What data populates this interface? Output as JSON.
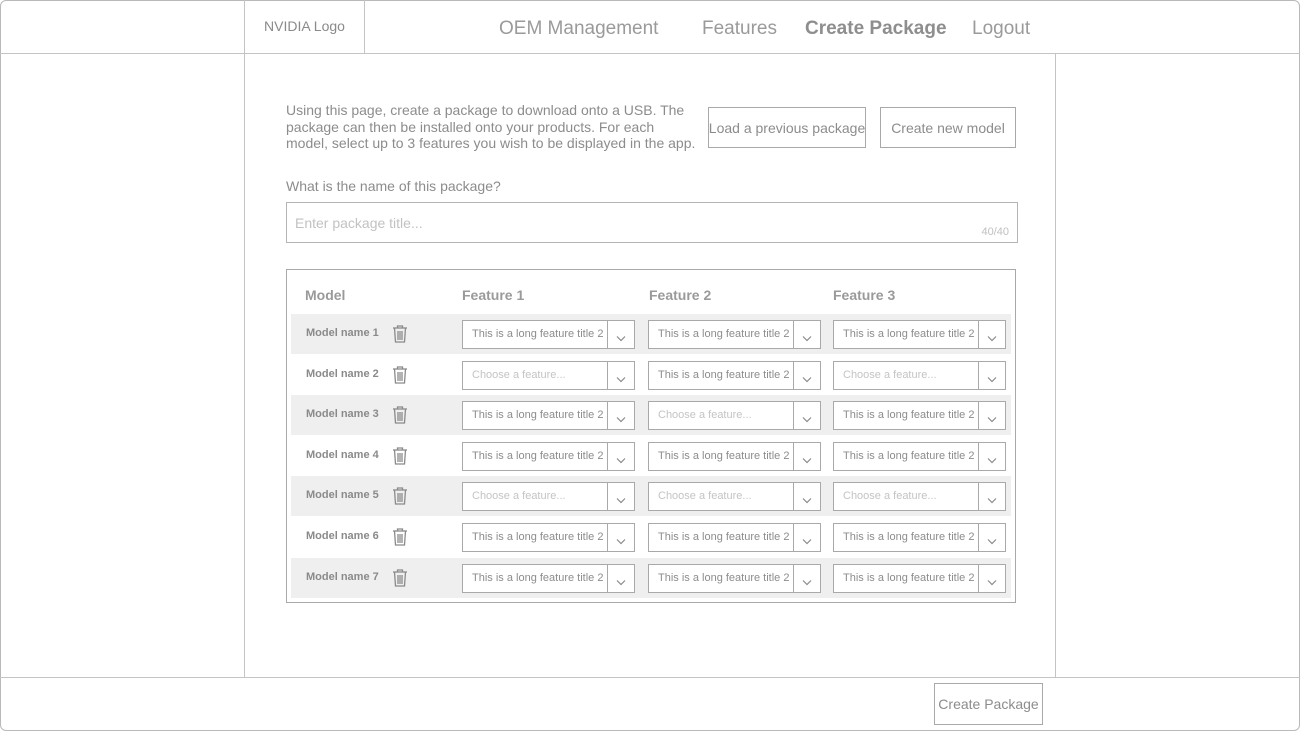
{
  "header": {
    "logo": "NVIDIA Logo",
    "nav": [
      {
        "label": "OEM Management",
        "active": false
      },
      {
        "label": "Features",
        "active": false
      },
      {
        "label": "Create Package",
        "active": true
      },
      {
        "label": "Logout",
        "active": false
      }
    ]
  },
  "intro": {
    "text": "Using this page, create a package to download onto a USB. The package can then be installed onto your products. For each model, select up to 3 features you wish to be displayed in the app.",
    "load_button": "Load a previous package",
    "new_model_button": "Create new model"
  },
  "package": {
    "question": "What is the name of this package?",
    "placeholder": "Enter package title...",
    "char_count": "40/40"
  },
  "table": {
    "headers": {
      "model": "Model",
      "f1": "Feature 1",
      "f2": "Feature 2",
      "f3": "Feature 3"
    },
    "placeholder": "Choose a feature...",
    "rows": [
      {
        "name": "Model name 1",
        "features": [
          "This is a long feature title 2",
          "This is a long feature title 2",
          "This is a long feature title 2"
        ]
      },
      {
        "name": "Model name 2",
        "features": [
          "",
          "This is a long feature title 2",
          ""
        ]
      },
      {
        "name": "Model name 3",
        "features": [
          "This is a long feature title 2",
          "",
          "This is a long feature title 2"
        ]
      },
      {
        "name": "Model name 4",
        "features": [
          "This is a long feature title 2",
          "This is a long feature title 2",
          "This is a long feature title 2"
        ]
      },
      {
        "name": "Model name 5",
        "features": [
          "",
          "",
          ""
        ]
      },
      {
        "name": "Model name 6",
        "features": [
          "This is a long feature title 2",
          "This is a long feature title 2",
          "This is a long feature title 2"
        ]
      },
      {
        "name": "Model name 7",
        "features": [
          "This is a long feature title 2",
          "This is a long feature title 2",
          "This is a long feature title 2"
        ]
      }
    ]
  },
  "footer": {
    "create_button": "Create Package"
  },
  "icons": {
    "delete": "trash-icon",
    "dropdown": "chevron-down-icon"
  }
}
